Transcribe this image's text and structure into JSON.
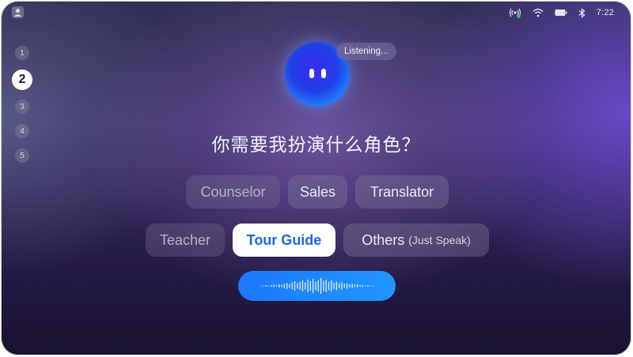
{
  "status_bar": {
    "user_icon": "user-icon",
    "icons": [
      "hotspot-icon",
      "wifi-icon",
      "battery-icon",
      "bluetooth-icon"
    ],
    "time": "7:22"
  },
  "steps": {
    "items": [
      "1",
      "2",
      "3",
      "4",
      "5"
    ],
    "active": "2"
  },
  "assistant": {
    "status": "Listening...",
    "question": "你需要我扮演什么角色？"
  },
  "roles": {
    "row1": [
      {
        "label": "Counselor",
        "state": "dim"
      },
      {
        "label": "Sales",
        "state": "normal"
      },
      {
        "label": "Translator",
        "state": "normal"
      }
    ],
    "row2": [
      {
        "label": "Teacher",
        "state": "dim"
      },
      {
        "label": "Tour Guide",
        "state": "selected"
      },
      {
        "label": "Others",
        "hint": "(Just Speak)",
        "state": "normal"
      }
    ]
  },
  "voice": {
    "icon": "waveform-icon"
  },
  "colors": {
    "accent": "#1e64e6",
    "voice_bar": "#1b86ff",
    "status_dot": "#2ecc71"
  }
}
